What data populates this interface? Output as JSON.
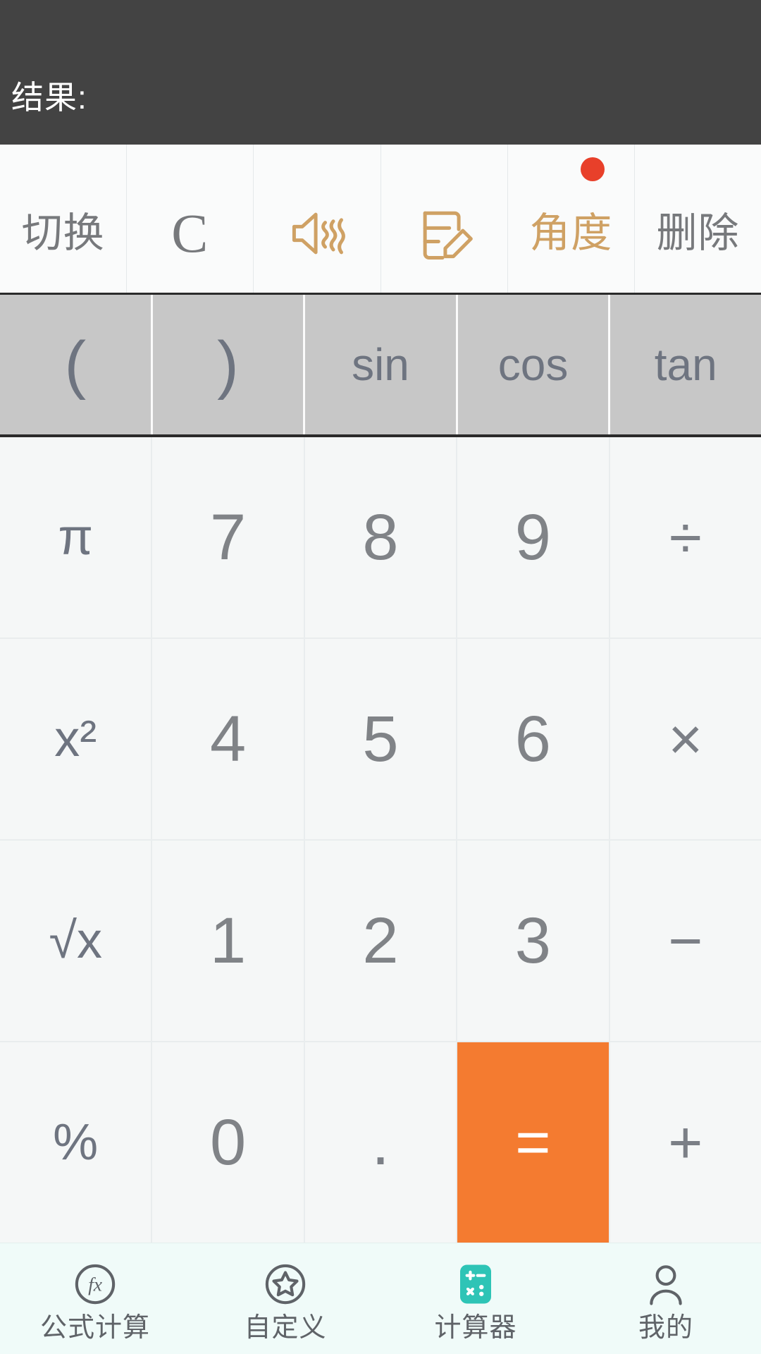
{
  "display": {
    "expression": "",
    "result_label": "结果:"
  },
  "toolbar": {
    "buttons": [
      {
        "name": "switch",
        "label": "切换",
        "style": "text",
        "color": "#77797c",
        "badge": false
      },
      {
        "name": "clear",
        "label": "C",
        "style": "text-serif",
        "color": "#77797c",
        "badge": false
      },
      {
        "name": "sound",
        "label": "",
        "style": "icon",
        "icon": "speaker-sound-icon",
        "color": "#cfa164",
        "badge": false
      },
      {
        "name": "note",
        "label": "",
        "style": "icon",
        "icon": "note-edit-icon",
        "color": "#cfa164",
        "badge": false
      },
      {
        "name": "angle",
        "label": "角度",
        "style": "text",
        "color": "#cfa164",
        "badge": true,
        "badge_color": "#e8402a"
      },
      {
        "name": "delete",
        "label": "删除",
        "style": "text",
        "color": "#77797c",
        "badge": false
      }
    ]
  },
  "function_row": {
    "background": "#c7c7c7",
    "buttons": [
      {
        "name": "open-paren",
        "label": "("
      },
      {
        "name": "close-paren",
        "label": ")"
      },
      {
        "name": "sin",
        "label": "sin"
      },
      {
        "name": "cos",
        "label": "cos"
      },
      {
        "name": "tan",
        "label": "tan"
      }
    ]
  },
  "keypad": {
    "accent": "#f47b30",
    "rows": [
      [
        {
          "name": "pi",
          "label": "π",
          "type": "fn"
        },
        {
          "name": "seven",
          "label": "7",
          "type": "digit"
        },
        {
          "name": "eight",
          "label": "8",
          "type": "digit"
        },
        {
          "name": "nine",
          "label": "9",
          "type": "digit"
        },
        {
          "name": "divide",
          "label": "÷",
          "type": "op"
        }
      ],
      [
        {
          "name": "x-squared",
          "label": "x²",
          "type": "fn"
        },
        {
          "name": "four",
          "label": "4",
          "type": "digit"
        },
        {
          "name": "five",
          "label": "5",
          "type": "digit"
        },
        {
          "name": "six",
          "label": "6",
          "type": "digit"
        },
        {
          "name": "multiply",
          "label": "×",
          "type": "op"
        }
      ],
      [
        {
          "name": "square-root",
          "label": "√x",
          "type": "fn"
        },
        {
          "name": "one",
          "label": "1",
          "type": "digit"
        },
        {
          "name": "two",
          "label": "2",
          "type": "digit"
        },
        {
          "name": "three",
          "label": "3",
          "type": "digit"
        },
        {
          "name": "minus",
          "label": "−",
          "type": "op"
        }
      ],
      [
        {
          "name": "percent",
          "label": "%",
          "type": "fn"
        },
        {
          "name": "zero",
          "label": "0",
          "type": "digit"
        },
        {
          "name": "decimal",
          "label": ".",
          "type": "dot"
        },
        {
          "name": "equals",
          "label": "=",
          "type": "equals"
        },
        {
          "name": "plus",
          "label": "+",
          "type": "op"
        }
      ]
    ]
  },
  "bottom_nav": {
    "active_index": 2,
    "active_color": "#2ec4b6",
    "items": [
      {
        "name": "formula-calc",
        "label": "公式计算",
        "icon": "fx-circle-icon"
      },
      {
        "name": "custom",
        "label": "自定义",
        "icon": "star-circle-icon"
      },
      {
        "name": "calculator",
        "label": "计算器",
        "icon": "calculator-icon"
      },
      {
        "name": "mine",
        "label": "我的",
        "icon": "person-icon"
      }
    ]
  }
}
